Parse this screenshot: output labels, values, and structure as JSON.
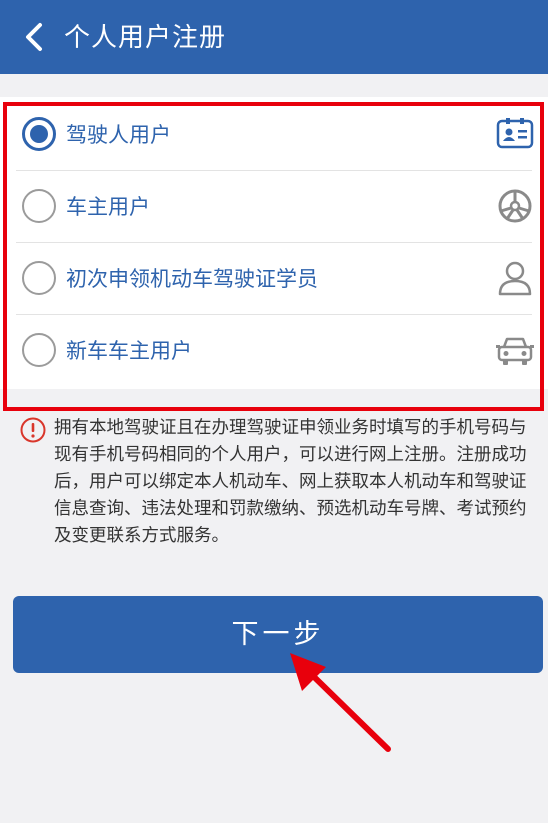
{
  "header": {
    "title": "个人用户注册",
    "bg_color": "#2e63ad",
    "back_icon": "chevron-left-icon"
  },
  "options": [
    {
      "label": "驾驶人用户",
      "checked": true,
      "icon": "id-card-icon"
    },
    {
      "label": "车主用户",
      "checked": false,
      "icon": "wheel-icon"
    },
    {
      "label": "初次申领机动车驾驶证学员",
      "checked": false,
      "icon": "person-icon"
    },
    {
      "label": "新车车主用户",
      "checked": false,
      "icon": "car-icon"
    }
  ],
  "notice": {
    "icon": "info-icon",
    "text": "拥有本地驾驶证且在办理驾驶证申领业务时填写的手机号码与现有手机号码相同的个人用户，可以进行网上注册。注册成功后，用户可以绑定本人机动车、网上获取本人机动车和驾驶证信息查询、违法处理和罚款缴纳、预选机动车号牌、考试预约及变更联系方式服务。"
  },
  "next_button": {
    "label": "下一步"
  },
  "colors": {
    "accent": "#2e63ad",
    "highlight": "#e8000c",
    "alert": "#d9362b"
  }
}
